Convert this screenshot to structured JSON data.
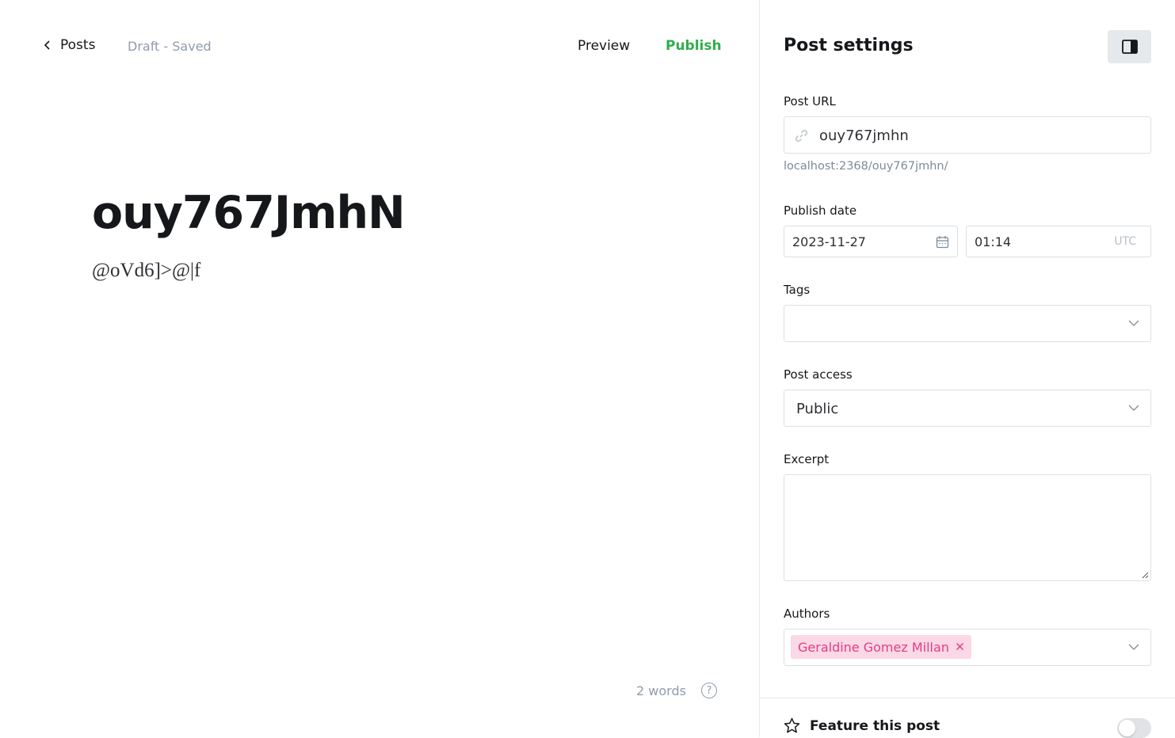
{
  "header": {
    "back_label": "Posts",
    "status": "Draft - Saved",
    "preview_label": "Preview",
    "publish_label": "Publish"
  },
  "post": {
    "title": "ouy767JmhN",
    "body": "@oVd6]>@|f",
    "word_count": "2 words"
  },
  "settings": {
    "title": "Post settings",
    "url_label": "Post URL",
    "url_value": "ouy767jmhn",
    "url_hint": "localhost:2368/ouy767jmhn/",
    "date_label": "Publish date",
    "date_value": "2023-11-27",
    "time_value": "01:14",
    "timezone": "UTC",
    "tags_label": "Tags",
    "tags_value": "",
    "access_label": "Post access",
    "access_value": "Public",
    "excerpt_label": "Excerpt",
    "excerpt_value": "",
    "authors_label": "Authors",
    "authors": [
      "Geraldine Gomez Millan"
    ],
    "feature_label": "Feature this post",
    "feature_enabled": false
  },
  "colors": {
    "accent_green": "#2fae4a",
    "author_chip_bg": "#fbd8e6",
    "author_chip_text": "#e33d84"
  },
  "icons": [
    "chevron-left-icon",
    "help-icon",
    "sidebar-toggle-icon",
    "link-icon",
    "calendar-icon",
    "chevron-down-icon",
    "close-icon",
    "star-icon"
  ]
}
